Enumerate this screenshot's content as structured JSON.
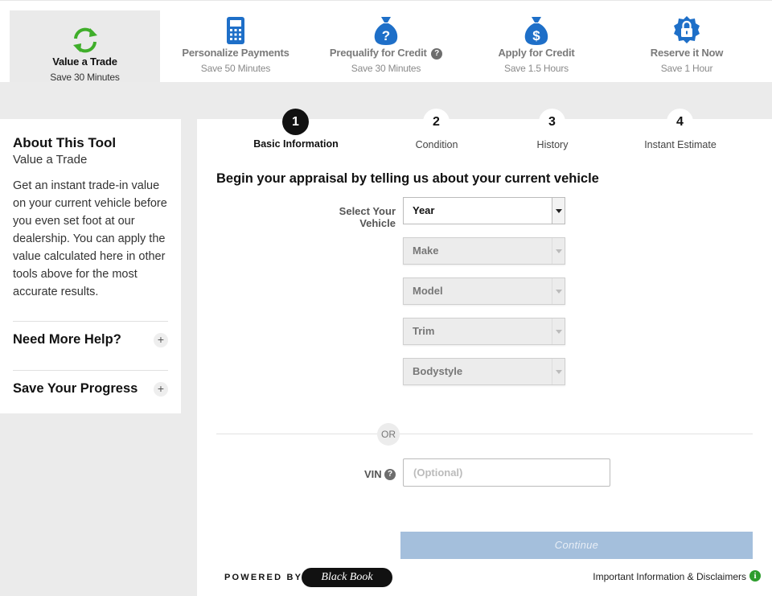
{
  "tabs": [
    {
      "label": "Value a Trade",
      "sub": "Save 30 Minutes",
      "icon": "refresh-icon"
    },
    {
      "label": "Personalize Payments",
      "sub": "Save 50 Minutes",
      "icon": "calculator-icon"
    },
    {
      "label": "Prequalify for Credit",
      "sub": "Save 30 Minutes",
      "icon": "money-bag-question-icon"
    },
    {
      "label": "Apply for Credit",
      "sub": "Save 1.5 Hours",
      "icon": "money-bag-dollar-icon"
    },
    {
      "label": "Reserve it Now",
      "sub": "Save 1 Hour",
      "icon": "lock-badge-icon"
    }
  ],
  "sidebar": {
    "title": "About This Tool",
    "subtitle": "Value a Trade",
    "description": "Get an instant trade-in value on your current vehicle before you even set foot at our dealership. You can apply the value calculated here in other tools above for the most accurate results.",
    "help_label": "Need More Help?",
    "save_label": "Save Your Progress",
    "plus": "+"
  },
  "steps": [
    {
      "num": "1",
      "label": "Basic Information"
    },
    {
      "num": "2",
      "label": "Condition"
    },
    {
      "num": "3",
      "label": "History"
    },
    {
      "num": "4",
      "label": "Instant Estimate"
    }
  ],
  "form": {
    "heading": "Begin your appraisal by telling us about your current vehicle",
    "select_label": "Select Your Vehicle",
    "year": "Year",
    "make": "Make",
    "model": "Model",
    "trim": "Trim",
    "bodystyle": "Bodystyle",
    "or": "OR",
    "vin_label": "VIN",
    "vin_placeholder": "(Optional)",
    "continue": "Continue"
  },
  "footer": {
    "powered": "POWERED BY",
    "brand": "Black Book",
    "disclaimer": "Important Information & Disclaimers"
  },
  "colors": {
    "active_green": "#3fae2a",
    "icon_blue": "#1e6fc8",
    "continue_disabled": "#a4bfdc",
    "info_green": "#2d9d2d"
  }
}
